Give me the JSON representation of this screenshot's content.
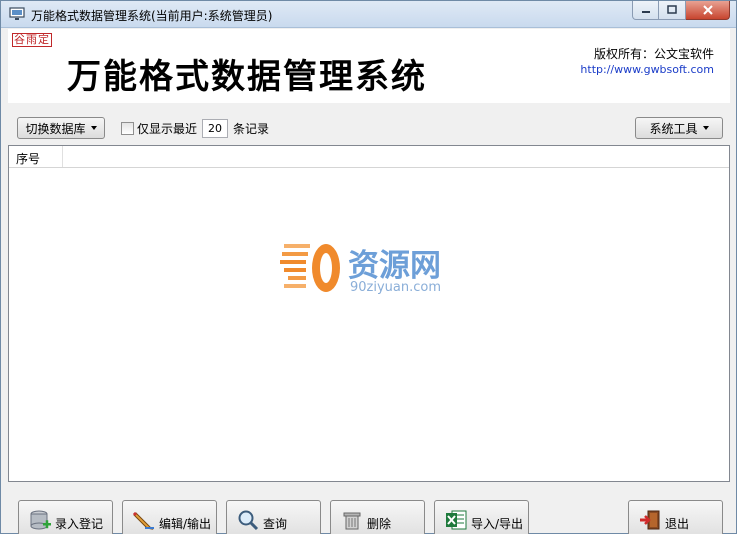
{
  "window": {
    "title": "万能格式数据管理系统(当前用户:系统管理员)"
  },
  "header": {
    "stamp": "谷雨定",
    "app_title": "万能格式数据管理系统",
    "copyright": "版权所有：公文宝软件",
    "url": "http://www.gwbsoft.com"
  },
  "toolbar": {
    "switch_db_label": "切换数据库",
    "recent_label": "仅显示最近",
    "recent_value": "20",
    "records_label": "条记录",
    "system_tools_label": "系统工具"
  },
  "grid": {
    "columns": [
      "序号"
    ]
  },
  "watermark": {
    "brand": "资源网",
    "url": "90ziyuan.com"
  },
  "actions": {
    "register_label": "录入登记",
    "edit_label": "编辑/输出",
    "query_label": "查询",
    "delete_label": "删除",
    "import_label": "导入/导出",
    "exit_label": "退出"
  },
  "colors": {
    "accent_blue": "#6d9fd8",
    "watermark_orange": "#f08a2c",
    "stamp_red": "#c0282a"
  }
}
